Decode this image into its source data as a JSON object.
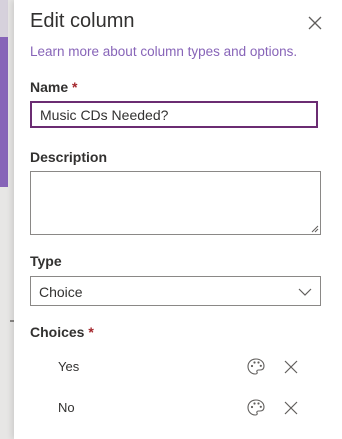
{
  "panel": {
    "title": "Edit column",
    "learn_more": "Learn more about column types and options."
  },
  "name_field": {
    "label": "Name",
    "required_mark": "*",
    "value": "Music CDs Needed?"
  },
  "description_field": {
    "label": "Description",
    "value": ""
  },
  "type_field": {
    "label": "Type",
    "selected": "Choice"
  },
  "choices_field": {
    "label": "Choices",
    "required_mark": "*",
    "items": [
      {
        "label": "Yes"
      },
      {
        "label": "No"
      }
    ]
  },
  "icons": {
    "close": "close-icon",
    "dropdown": "chevron-down-icon",
    "palette": "palette-icon",
    "remove": "remove-icon"
  },
  "colors": {
    "accent": "#8764b8",
    "focus_border": "#6b2c72",
    "required": "#a4262c",
    "text": "#323130"
  }
}
